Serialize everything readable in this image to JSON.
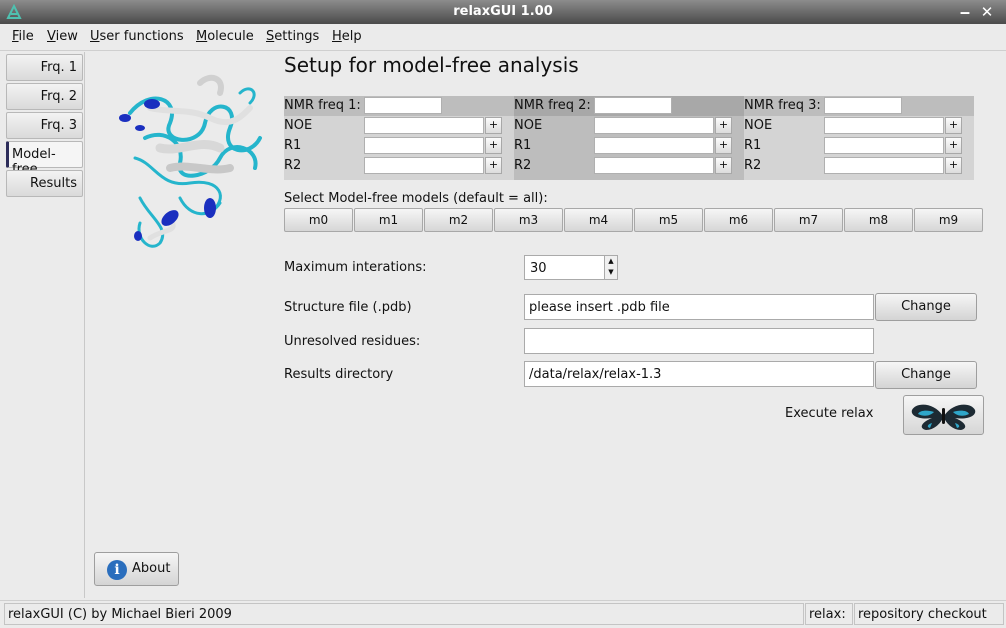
{
  "window": {
    "title": "relaxGUI 1.00",
    "minimize": "‒",
    "close": "✕"
  },
  "menu": [
    {
      "underline": "F",
      "rest": "ile"
    },
    {
      "underline": "V",
      "rest": "iew"
    },
    {
      "underline": "U",
      "rest": "ser functions"
    },
    {
      "underline": "M",
      "rest": "olecule"
    },
    {
      "underline": "S",
      "rest": "ettings"
    },
    {
      "underline": "H",
      "rest": "elp"
    }
  ],
  "tabs": [
    "Frq. 1",
    "Frq. 2",
    "Frq. 3",
    "Model-free",
    "Results"
  ],
  "active_tab": "Model-free",
  "heading": "Setup for model-free analysis",
  "freq_columns": [
    {
      "freq_label": "NMR freq 1:",
      "freq_value": "",
      "rows": [
        "NOE",
        "R1",
        "R2"
      ]
    },
    {
      "freq_label": "NMR freq 2:",
      "freq_value": "",
      "rows": [
        "NOE",
        "R1",
        "R2"
      ]
    },
    {
      "freq_label": "NMR freq 3:",
      "freq_value": "",
      "rows": [
        "NOE",
        "R1",
        "R2"
      ]
    }
  ],
  "plus_symbol": "+",
  "models_label": "Select Model-free models (default = all):",
  "models": [
    "m0",
    "m1",
    "m2",
    "m3",
    "m4",
    "m5",
    "m6",
    "m7",
    "m8",
    "m9"
  ],
  "max_iterations": {
    "label": "Maximum interations:",
    "value": "30",
    "up": "▲",
    "down": "▼"
  },
  "structure_file": {
    "label": "Structure file (.pdb)",
    "value": "please insert .pdb file",
    "button": "Change"
  },
  "unresolved": {
    "label": "Unresolved residues:",
    "value": ""
  },
  "results_dir": {
    "label": "Results directory",
    "value": "/data/relax/relax-1.3",
    "button": "Change"
  },
  "execute": {
    "label": "Execute relax",
    "icon": "butterfly-icon"
  },
  "about": {
    "label": "About",
    "icon_glyph": "i"
  },
  "status": {
    "left": "relaxGUI (C) by Michael Bieri 2009",
    "middle": "relax:",
    "right": "repository checkout"
  },
  "colors": {
    "titlebar": "#5a5a5a",
    "panel_light": "#d4d4d4",
    "panel_dark": "#bdbdbd",
    "protein_cyan": "#25b5cc",
    "protein_blue": "#1a2fbf"
  }
}
